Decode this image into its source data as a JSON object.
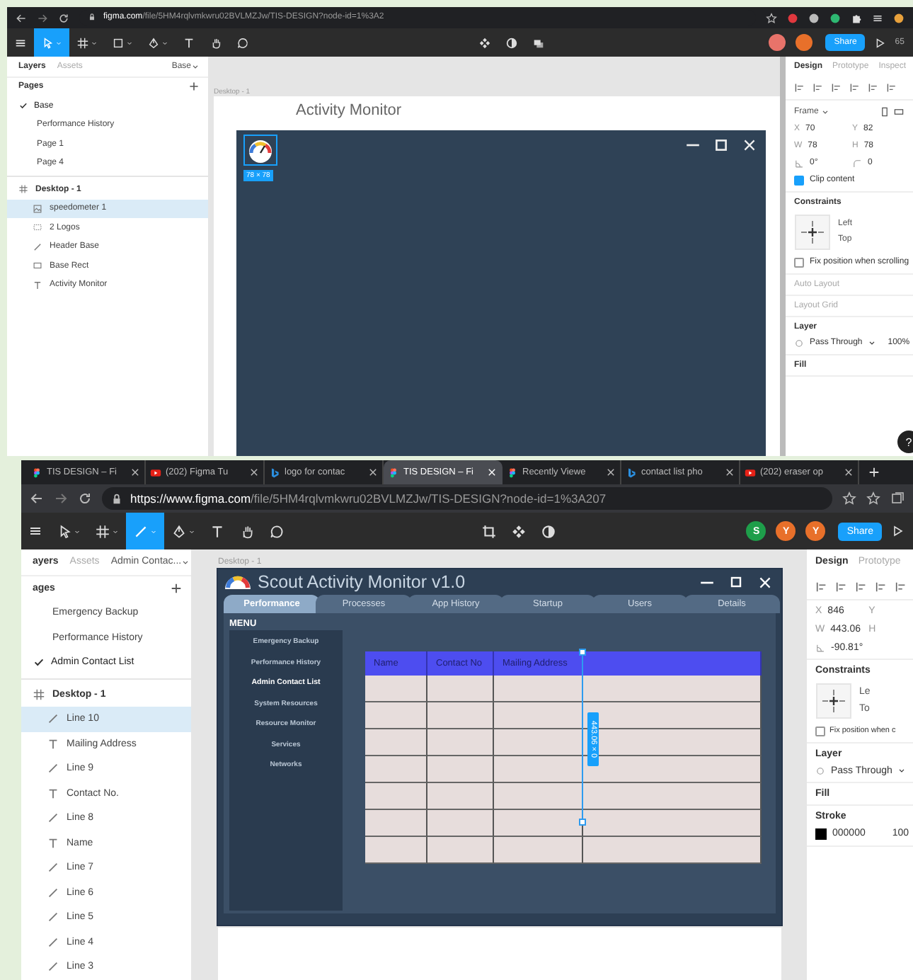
{
  "top_shot": {
    "browser": {
      "url_host": "figma.com",
      "url_path": "/file/5HM4rqlvmkwru02BVLMZJw/TIS-DESIGN?node-id=1%3A2"
    },
    "toolbar": {
      "tools": [
        {
          "kind": "move",
          "selected": true
        },
        {
          "kind": "frame",
          "selected": false
        },
        {
          "kind": "shape",
          "selected": false
        },
        {
          "kind": "pen",
          "selected": false
        },
        {
          "kind": "text",
          "selected": false
        },
        {
          "kind": "hand",
          "selected": false
        },
        {
          "kind": "comment",
          "selected": false
        }
      ],
      "center_tools": [
        {
          "kind": "component"
        },
        {
          "kind": "contrast"
        },
        {
          "kind": "layers"
        }
      ],
      "avatars": [
        {
          "color": "#e8736a"
        },
        {
          "color": "#e8702a"
        }
      ],
      "share": "Share",
      "zoom": "65"
    },
    "layers_panel": {
      "tabs": [
        {
          "label": "Layers",
          "selected": true
        },
        {
          "label": "Assets",
          "selected": false
        }
      ],
      "page_menu": "Base",
      "pages_title": "Pages",
      "pages": [
        {
          "name": "Base",
          "selected": true
        },
        {
          "name": "Performance History",
          "selected": false
        },
        {
          "name": "Page 1",
          "selected": false
        },
        {
          "name": "Page 4",
          "selected": false
        }
      ],
      "layers": [
        {
          "name": "Desktop - 1",
          "kind": "frame",
          "selected": false,
          "children": [
            {
              "name": "speedometer 1",
              "kind": "image",
              "selected": true
            },
            {
              "name": "2 Logos",
              "kind": "group",
              "selected": false
            },
            {
              "name": "Header Base",
              "kind": "line",
              "selected": false
            },
            {
              "name": "Base Rect",
              "kind": "rect",
              "selected": false
            },
            {
              "name": "Activity Monitor",
              "kind": "text",
              "selected": false
            }
          ]
        }
      ]
    },
    "canvas": {
      "frame_label": "Desktop - 1",
      "heading": "Activity Monitor",
      "size_badge": "78 × 78"
    },
    "design_panel": {
      "tabs": [
        {
          "label": "Design",
          "selected": true
        },
        {
          "label": "Prototype",
          "selected": false
        },
        {
          "label": "Inspect",
          "selected": false
        }
      ],
      "section_title": "Frame",
      "fields": [
        {
          "kind": "label",
          "label": "X",
          "value": "70"
        },
        {
          "kind": "label",
          "label": "Y",
          "value": "82"
        },
        {
          "kind": "label",
          "label": "W",
          "value": "78"
        },
        {
          "kind": "label",
          "label": "H",
          "value": "78"
        },
        {
          "kind": "rotation",
          "value": "0°"
        },
        {
          "kind": "radius",
          "value": "0"
        }
      ],
      "clip_content": {
        "label": "Clip content",
        "checked": true
      },
      "constraints": {
        "title": "Constraints",
        "horizontal": "Left",
        "vertical": "Top"
      },
      "fix_position": {
        "label": "Fix position when scrolling",
        "checked": false
      },
      "sections": [
        "Auto Layout",
        "Layout Grid"
      ],
      "layer": {
        "title": "Layer",
        "blend": "Pass Through",
        "opacity": "100%"
      },
      "fill": {
        "title": "Fill"
      },
      "help": "?"
    }
  },
  "bottom_shot": {
    "browser_tabs": [
      {
        "kind": "figma",
        "title": "TIS DESIGN – Fi",
        "selected": false
      },
      {
        "kind": "youtube",
        "title": "(202) Figma Tu",
        "selected": false
      },
      {
        "kind": "bing",
        "title": "logo for contac",
        "selected": false
      },
      {
        "kind": "figma",
        "title": "TIS DESIGN – Fi",
        "selected": true
      },
      {
        "kind": "figma",
        "title": "Recently Viewe",
        "selected": false
      },
      {
        "kind": "bing",
        "title": "contact list pho",
        "selected": false
      },
      {
        "kind": "youtube",
        "title": "(202) eraser op",
        "selected": false
      }
    ],
    "browser": {
      "url_host": "https://www.figma.com",
      "url_path": "/file/5HM4rqlvmkwru02BVLMZJw/TIS-DESIGN?node-id=1%3A207"
    },
    "toolbar": {
      "tools": [
        {
          "kind": "move",
          "selected": false
        },
        {
          "kind": "frame",
          "selected": false
        },
        {
          "kind": "line",
          "selected": true
        },
        {
          "kind": "pen",
          "selected": false
        },
        {
          "kind": "text",
          "selected": false
        },
        {
          "kind": "hand",
          "selected": false
        },
        {
          "kind": "comment",
          "selected": false
        }
      ],
      "center_tools": [
        {
          "kind": "crop"
        },
        {
          "kind": "component"
        },
        {
          "kind": "contrast"
        }
      ],
      "avatars": [
        {
          "initial": "S",
          "color": "#1e9e4a"
        },
        {
          "initial": "Y",
          "color": "#e8702a"
        },
        {
          "initial": "Y",
          "color": "#e8702a"
        }
      ],
      "share": "Share"
    },
    "layers_panel": {
      "tabs": [
        {
          "label": "ayers",
          "selected": true
        },
        {
          "label": "Assets",
          "selected": false
        }
      ],
      "page_menu": "Admin Contac...",
      "pages_title": "ages",
      "pages": [
        {
          "name": "Emergency Backup",
          "selected": false
        },
        {
          "name": "Performance History",
          "selected": false
        },
        {
          "name": "Admin Contact List",
          "selected": true
        }
      ],
      "layers": [
        {
          "name": "Desktop - 1",
          "kind": "frame",
          "selected": false,
          "children": [
            {
              "name": "Line 10",
              "kind": "line",
              "selected": true
            },
            {
              "name": "Mailing Address",
              "kind": "text",
              "selected": false
            },
            {
              "name": "Line 9",
              "kind": "line",
              "selected": false
            },
            {
              "name": "Contact No.",
              "kind": "text",
              "selected": false
            },
            {
              "name": "Line 8",
              "kind": "line",
              "selected": false
            },
            {
              "name": "Name",
              "kind": "text",
              "selected": false
            },
            {
              "name": "Line 7",
              "kind": "line",
              "selected": false
            },
            {
              "name": "Line 6",
              "kind": "line",
              "selected": false
            },
            {
              "name": "Line 5",
              "kind": "line",
              "selected": false
            },
            {
              "name": "Line 4",
              "kind": "line",
              "selected": false
            },
            {
              "name": "Line 3",
              "kind": "line",
              "selected": false
            }
          ]
        }
      ]
    },
    "canvas": {
      "frame_label": "Desktop - 1",
      "window": {
        "title": "Scout Activity Monitor v1.0",
        "tabs": [
          {
            "label": "Performance",
            "selected": true
          },
          {
            "label": "Processes",
            "selected": false
          },
          {
            "label": "App History",
            "selected": false
          },
          {
            "label": "Startup",
            "selected": false
          },
          {
            "label": "Users",
            "selected": false
          },
          {
            "label": "Details",
            "selected": false
          }
        ],
        "menu_title": "MENU",
        "menu": [
          {
            "label": "Emergency Backup",
            "selected": false
          },
          {
            "label": "Performance History",
            "selected": false
          },
          {
            "label": "Admin Contact List",
            "selected": true
          },
          {
            "label": "System Resources",
            "selected": false
          },
          {
            "label": "Resource Monitor",
            "selected": false
          },
          {
            "label": "Services",
            "selected": false
          },
          {
            "label": "Networks",
            "selected": false
          }
        ],
        "table": {
          "columns": [
            "Name",
            "Contact No",
            "Mailing Address"
          ]
        }
      },
      "measure_badge": "443.06 × 0"
    },
    "design_panel": {
      "tabs": [
        {
          "label": "Design",
          "selected": true
        },
        {
          "label": "Prototype",
          "selected": false
        }
      ],
      "fields": [
        {
          "kind": "label",
          "label": "X",
          "value": "846"
        },
        {
          "kind": "label",
          "label": "Y"
        },
        {
          "kind": "label",
          "label": "W",
          "value": "443.06"
        },
        {
          "kind": "label",
          "label": "H"
        },
        {
          "kind": "rotation",
          "value": "-90.81°"
        }
      ],
      "constraints": {
        "title": "Constraints",
        "horizontal": "Le",
        "vertical": "To"
      },
      "fix_position": {
        "label": "Fix position when c",
        "checked": false
      },
      "layer": {
        "title": "Layer",
        "blend": "Pass Through"
      },
      "fill": {
        "title": "Fill"
      },
      "stroke": {
        "title": "Stroke",
        "hex": "000000",
        "opacity": "100"
      }
    }
  }
}
